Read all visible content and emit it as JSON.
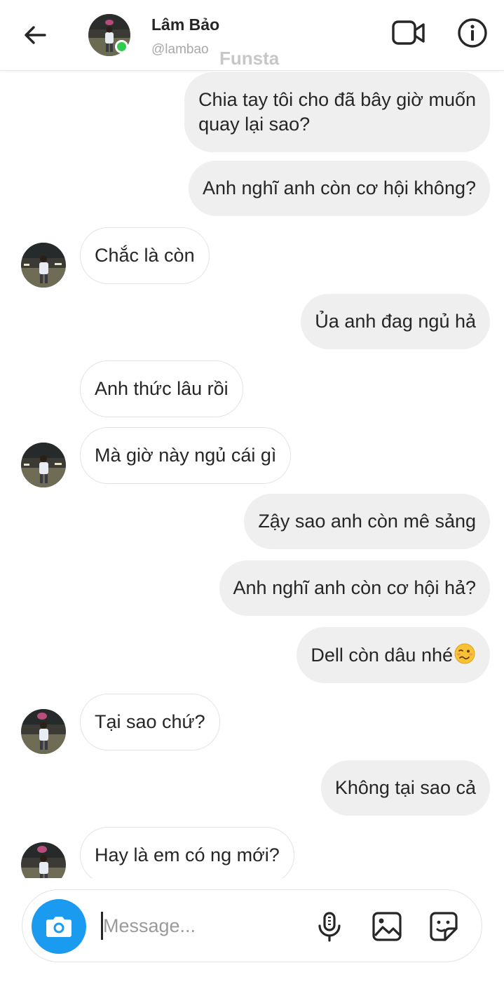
{
  "header": {
    "name": "Lâm Bảo",
    "handle": "@lambao",
    "watermark": "Funsta"
  },
  "messages": [
    {
      "from": "me",
      "lines": [
        "Chia tay tôi cho đã bây giờ muốn",
        "quay lại sao?"
      ]
    },
    {
      "from": "me",
      "text": "Anh nghĩ anh còn cơ hội không?"
    },
    {
      "from": "them",
      "text": "Chắc là còn"
    },
    {
      "from": "me",
      "text": "Ủa anh đag ngủ hả"
    },
    {
      "from": "them",
      "text": "Anh thức lâu rồi"
    },
    {
      "from": "them",
      "text": "Mà giờ này ngủ cái gì"
    },
    {
      "from": "me",
      "text": "Zậy sao anh còn mê sảng"
    },
    {
      "from": "me",
      "text": "Anh nghĩ anh còn cơ hội hả?"
    },
    {
      "from": "me",
      "text": "Dell còn dâu nhé",
      "emoji": "woozy-face"
    },
    {
      "from": "them",
      "text": "Tại sao chứ?"
    },
    {
      "from": "me",
      "text": "Không tại sao cả"
    },
    {
      "from": "them",
      "text": "Hay là em có ng mới?"
    }
  ],
  "composer": {
    "placeholder": "Message..."
  },
  "colors": {
    "accent": "#1a9bf0",
    "online": "#2ecc4f",
    "sent_bubble": "#efefef"
  },
  "icons": [
    "back-arrow-icon",
    "video-call-icon",
    "info-icon",
    "camera-icon",
    "microphone-icon",
    "gallery-icon",
    "sticker-icon"
  ]
}
